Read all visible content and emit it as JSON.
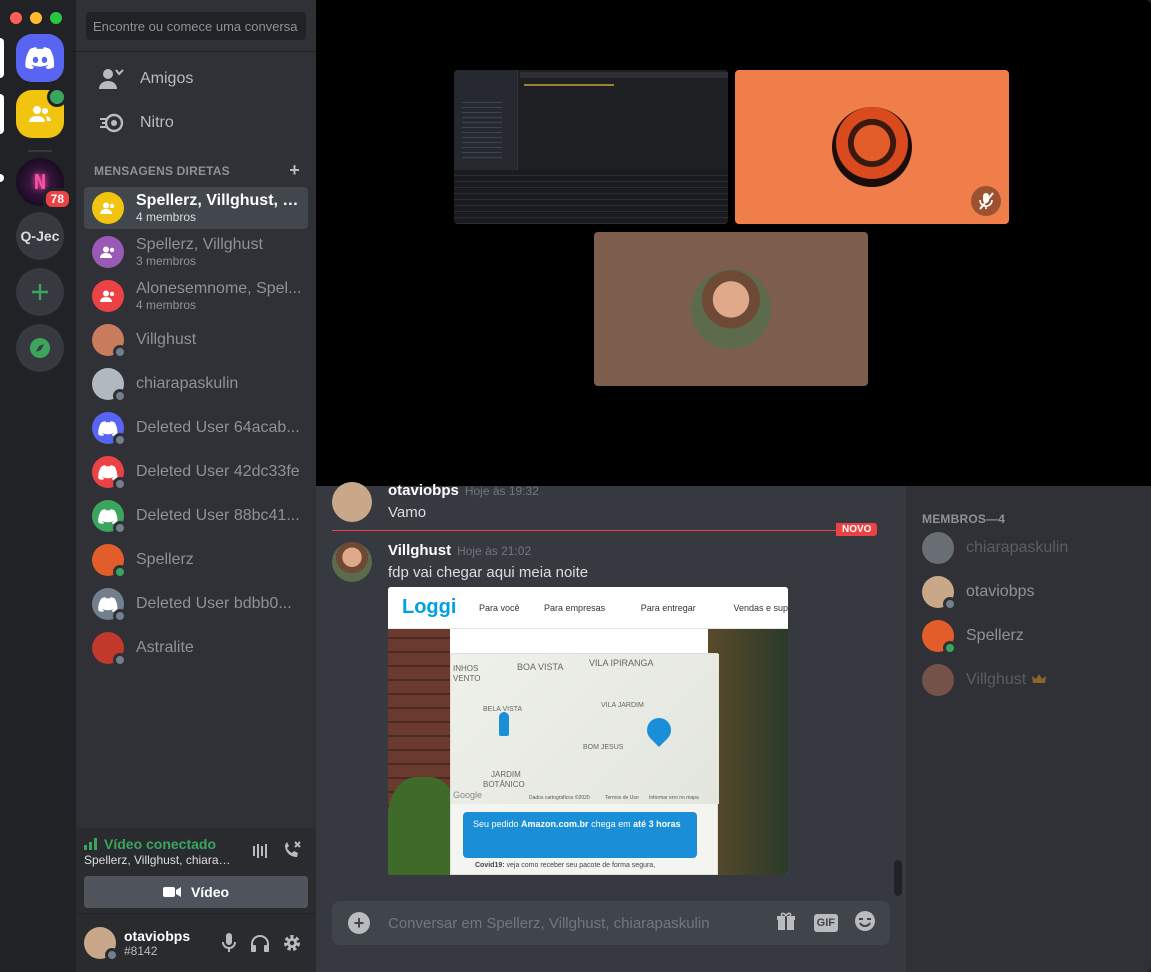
{
  "colors": {
    "blurple": "#5865f2",
    "green": "#3ba55d",
    "red": "#ed4245",
    "yellow": "#faa61a",
    "gold": "#f1c40f",
    "orange": "#f07e4b",
    "purple": "#9b59b6",
    "teal": "#1abc9c",
    "gray": "#747f8d"
  },
  "rail": {
    "badge": "78",
    "qjec": "Q-Jec",
    "add_icon": "plus-icon",
    "explore_icon": "compass-icon"
  },
  "sidebar": {
    "search_placeholder": "Encontre ou comece uma conversa",
    "nav": [
      {
        "label": "Amigos",
        "icon": "friends-icon"
      },
      {
        "label": "Nitro",
        "icon": "nitro-icon"
      }
    ],
    "dm_header": "MENSAGENS DIRETAS",
    "dms": [
      {
        "name": "Spellerz, Villghust, ch...",
        "sub": "4 membros",
        "type": "group",
        "color": "#f1c40f",
        "selected": true
      },
      {
        "name": "Spellerz, Villghust",
        "sub": "3 membros",
        "type": "group",
        "color": "#9b59b6"
      },
      {
        "name": "Alonesemnome, Spel...",
        "sub": "4 membros",
        "type": "group",
        "color": "#ed4245"
      },
      {
        "name": "Villghust",
        "type": "user",
        "color": "#c97c5d"
      },
      {
        "name": "chiarapaskulin",
        "type": "user",
        "color": "#b0b8c0"
      },
      {
        "name": "Deleted User 64acab...",
        "type": "deleted",
        "color": "#5865f2"
      },
      {
        "name": "Deleted User 42dc33fe",
        "type": "deleted",
        "color": "#ed4245"
      },
      {
        "name": "Deleted User 88bc41...",
        "type": "deleted",
        "color": "#3ba55d"
      },
      {
        "name": "Spellerz",
        "type": "user",
        "color": "#e25d2a",
        "online": true
      },
      {
        "name": "Deleted User bdbb0...",
        "type": "deleted",
        "color": "#747f8d"
      },
      {
        "name": "Astralite",
        "type": "user",
        "color": "#c0392b"
      }
    ]
  },
  "voice": {
    "status": "Vídeo conectado",
    "channel": "Spellerz, Villghust, chiarapa...",
    "video_button": "Vídeo"
  },
  "user": {
    "name": "otaviobps",
    "tag": "#8142"
  },
  "chat": {
    "messages": [
      {
        "author": "otaviobps",
        "time": "Hoje às 19:32",
        "text": "Vamo"
      },
      {
        "author": "Villghust",
        "time": "Hoje às 21:02",
        "text": "fdp vai chegar aqui meia noite"
      }
    ],
    "new_label": "NOVO",
    "composer_placeholder": "Conversar em Spellerz, Villghust, chiarapaskulin",
    "gif": "GIF"
  },
  "embed": {
    "brand": "Loggi",
    "nav": [
      "Para você",
      "Para empresas",
      "Para entregar",
      "Vendas e sup"
    ],
    "map_labels": [
      "BOA VISTA",
      "VILA IPIRANGA",
      "INHOS",
      "VENTO",
      "BELA VISTA",
      "VILA JARDIM",
      "BOM JESUS",
      "JARDIM",
      "BOTÂNICO"
    ],
    "map_footer": [
      "Dados cartográficos ©2020",
      "Termos de Uso",
      "Informar erro no mapa"
    ],
    "google": "Google",
    "notice_pre": "Seu pedido ",
    "notice_bold": "Amazon.com.br",
    "notice_mid": " chega em ",
    "notice_bold2": "até 3 horas",
    "covid_bold": "Covid19:",
    "covid": " veja como receber seu pacote de forma segura,"
  },
  "members": {
    "header": "MEMBROS—4",
    "list": [
      {
        "name": "chiarapaskulin",
        "color": "#b0b8c0",
        "dim": true
      },
      {
        "name": "otaviobps",
        "color": "#c9a88a"
      },
      {
        "name": "Spellerz",
        "color": "#e25d2a",
        "online": true
      },
      {
        "name": "Villghust",
        "color": "#c97c5d",
        "dim": true,
        "owner": true
      }
    ]
  }
}
